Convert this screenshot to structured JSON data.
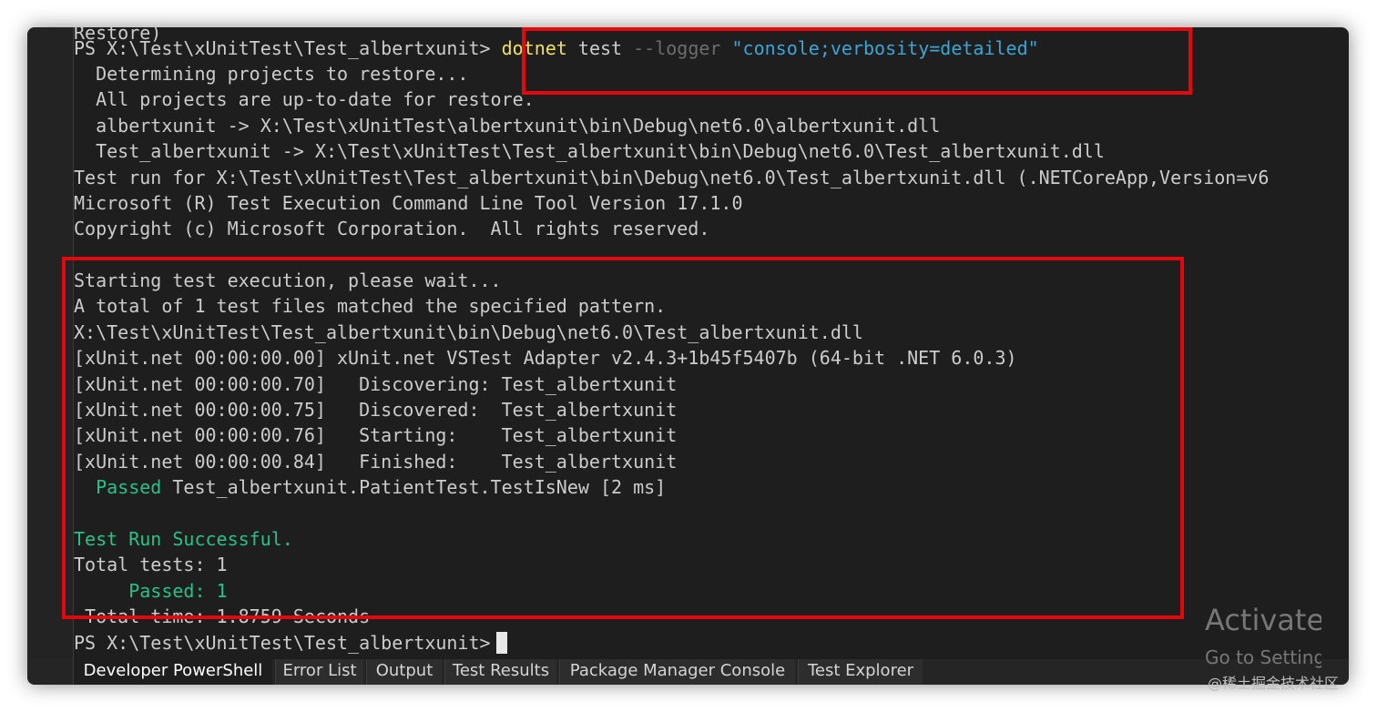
{
  "terminal": {
    "line0": "Restore)",
    "prompt_path": "PS X:\\Test\\xUnitTest\\Test_albertxunit>",
    "cmd_name": "dotnet",
    "cmd_arg": "test",
    "cmd_flag": "--logger",
    "cmd_string": "\"console;verbosity=detailed\"",
    "line2": "  Determining projects to restore...",
    "line3": "  All projects are up-to-date for restore.",
    "line4": "  albertxunit -> X:\\Test\\xUnitTest\\albertxunit\\bin\\Debug\\net6.0\\albertxunit.dll",
    "line5": "  Test_albertxunit -> X:\\Test\\xUnitTest\\Test_albertxunit\\bin\\Debug\\net6.0\\Test_albertxunit.dll",
    "line6": "Test run for X:\\Test\\xUnitTest\\Test_albertxunit\\bin\\Debug\\net6.0\\Test_albertxunit.dll (.NETCoreApp,Version=v6",
    "line7": "Microsoft (R) Test Execution Command Line Tool Version 17.1.0",
    "line8": "Copyright (c) Microsoft Corporation.  All rights reserved.",
    "line10": "Starting test execution, please wait...",
    "line11": "A total of 1 test files matched the specified pattern.",
    "line12": "X:\\Test\\xUnitTest\\Test_albertxunit\\bin\\Debug\\net6.0\\Test_albertxunit.dll",
    "line13": "[xUnit.net 00:00:00.00] xUnit.net VSTest Adapter v2.4.3+1b45f5407b (64-bit .NET 6.0.3)",
    "line14": "[xUnit.net 00:00:00.70]   Discovering: Test_albertxunit",
    "line15": "[xUnit.net 00:00:00.75]   Discovered:  Test_albertxunit",
    "line16": "[xUnit.net 00:00:00.76]   Starting:    Test_albertxunit",
    "line17": "[xUnit.net 00:00:00.84]   Finished:    Test_albertxunit",
    "passed_word": "  Passed",
    "passed_rest": " Test_albertxunit.PatientTest.TestIsNew [2 ms]",
    "run_success": "Test Run Successful.",
    "total_tests": "Total tests: 1",
    "passed_count": "     Passed: 1",
    "total_time": " Total time: 1.8759 Seconds",
    "final_prompt": "PS X:\\Test\\xUnitTest\\Test_albertxunit>"
  },
  "tabs": [
    {
      "label": "Developer PowerShell"
    },
    {
      "label": "Error List"
    },
    {
      "label": "Output"
    },
    {
      "label": "Test Results"
    },
    {
      "label": "Package Manager Console"
    },
    {
      "label": "Test Explorer"
    }
  ],
  "watermark": {
    "title": "Activate Windows",
    "subtitle": "Go to Settings to activate Windows.",
    "site": "@稀土掘金技术社区"
  },
  "colors": {
    "terminal_bg": "#1e1e1e",
    "text": "#cccccc",
    "success_green": "#23c38a",
    "command_yellow": "#f0e060",
    "string_blue": "#3aa6d8",
    "highlight_red": "#e4080d"
  }
}
